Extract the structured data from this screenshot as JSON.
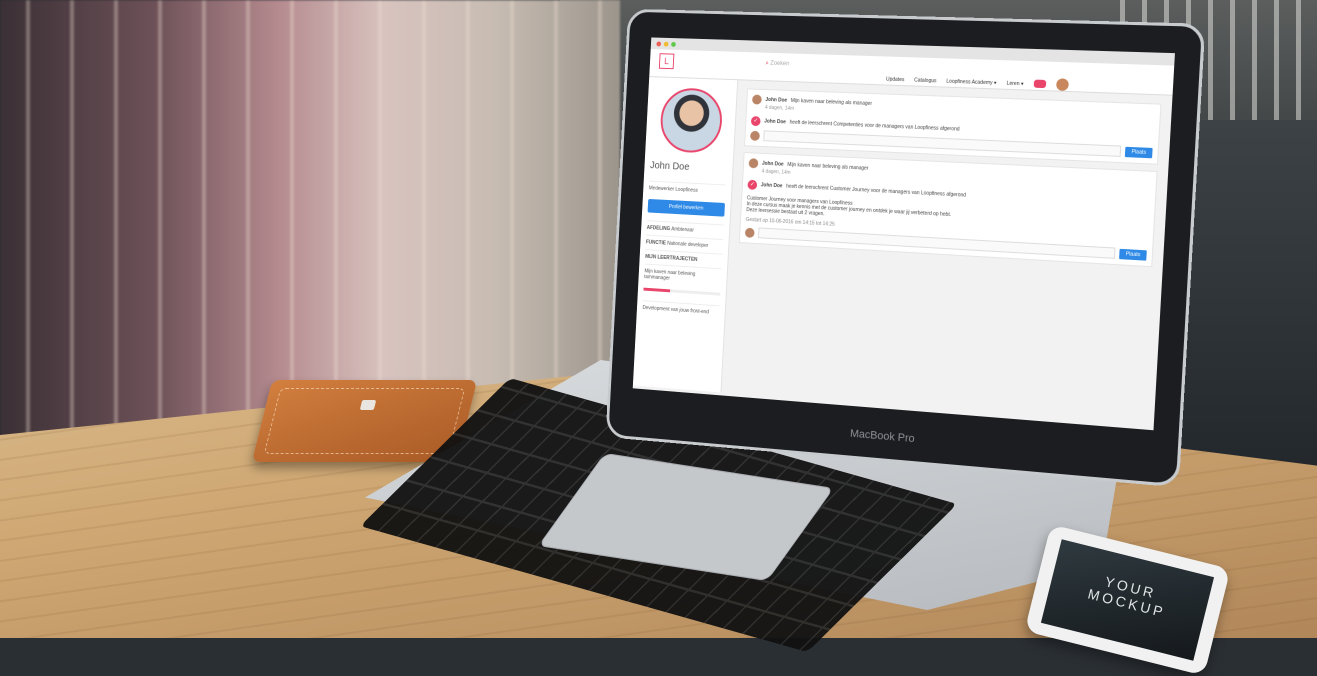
{
  "scene": {
    "laptop_brand": "MacBook Pro",
    "phone_text": [
      "YOUR",
      "MOCKUP"
    ]
  },
  "app": {
    "search_placeholder": "Zoeken",
    "nav": [
      "Updates",
      "Catalogus",
      "Loopfiness Academy ▾",
      "Leren ▾"
    ],
    "sidebar": {
      "user_name": "John Doe",
      "company": "Medewerker Loopfiness",
      "edit_button": "Profiel bewerken",
      "rows": [
        {
          "label": "AFDELING",
          "value": "Ambtenaar"
        },
        {
          "label": "FUNCTIE",
          "value": "Nationale developer"
        }
      ],
      "section_title": "MIJN LEERTRAJECTEN",
      "course": "Mijn kaven naar beleving tammanager",
      "course_progress": 0.35,
      "footer_text": "Development van jouw front-end"
    },
    "feed": {
      "post1": {
        "author": "John Doe",
        "context": "Mijn kaven naar beleving als manager",
        "time": "4 dagen, 14m",
        "body_author": "John Doe",
        "body_text": "heeft de leerschrent Competenties voor de managers van Loopfiness afgerond"
      },
      "post2": {
        "author": "John Doe",
        "context": "Mijn kaven naar beleving als manager",
        "time": "4 dagen, 14m",
        "body_author": "John Doe",
        "body_text": "heeft de leerschrent Customer Journey voor de managers van Loopfiness afgerond",
        "desc_title": "Customer Journey voor managers van Loopfiness",
        "desc_line1": "In deze cursus maak je kennis met de customer journey en ontdek je waar jij verbeterd op hebt.",
        "desc_line2": "Deze leersessie bestaat uit 2 vragen.",
        "meta": "Gestart op 10-06-2016 om 14:15 tot 14:25"
      },
      "post_button": "Plaats"
    }
  }
}
